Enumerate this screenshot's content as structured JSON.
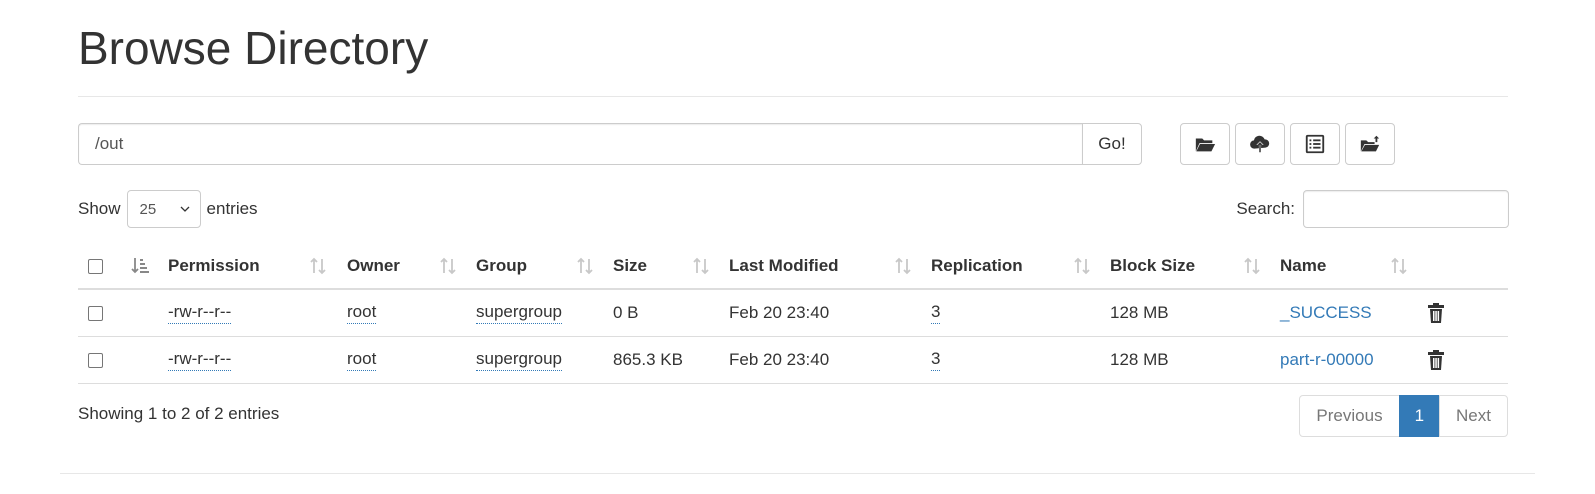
{
  "page": {
    "title": "Browse Directory"
  },
  "path_bar": {
    "value": "/out",
    "go_label": "Go!"
  },
  "toolbar": {
    "buttons": [
      {
        "icon": "folder-open-icon"
      },
      {
        "icon": "cloud-upload-icon"
      },
      {
        "icon": "list-alt-icon"
      },
      {
        "icon": "folder-upload-icon"
      }
    ]
  },
  "length": {
    "show_label": "Show",
    "selected": "25",
    "entries_label": "entries"
  },
  "search": {
    "label": "Search:",
    "value": ""
  },
  "table": {
    "columns": [
      "Permission",
      "Owner",
      "Group",
      "Size",
      "Last Modified",
      "Replication",
      "Block Size",
      "Name"
    ],
    "rows": [
      {
        "permission": "-rw-r--r--",
        "owner": "root",
        "group": "supergroup",
        "size": "0 B",
        "modified": "Feb 20 23:40",
        "replication": "3",
        "block_size": "128 MB",
        "name": "_SUCCESS"
      },
      {
        "permission": "-rw-r--r--",
        "owner": "root",
        "group": "supergroup",
        "size": "865.3 KB",
        "modified": "Feb 20 23:40",
        "replication": "3",
        "block_size": "128 MB",
        "name": "part-r-00000"
      }
    ]
  },
  "footer": {
    "info": "Showing 1 to 2 of 2 entries",
    "pagination": {
      "previous": "Previous",
      "current": "1",
      "next": "Next"
    }
  },
  "colors": {
    "link": "#337ab7",
    "active_page": "#337ab7",
    "border": "#dddddd",
    "text": "#333333"
  }
}
